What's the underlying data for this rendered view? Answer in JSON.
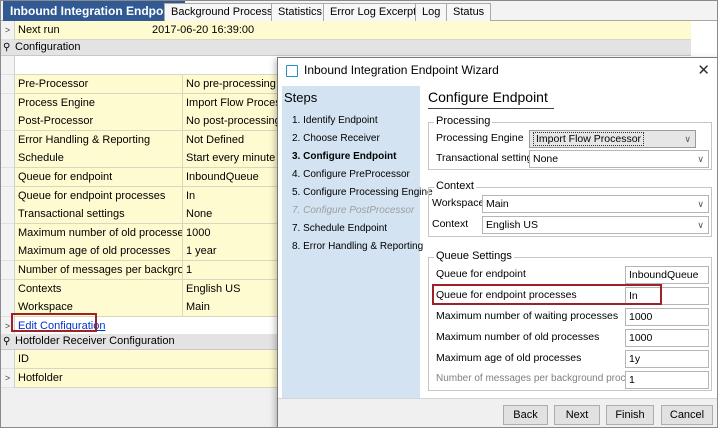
{
  "tabs": [
    {
      "label": "Inbound Integration Endpoint"
    },
    {
      "label": "Background Processes"
    },
    {
      "label": "Statistics"
    },
    {
      "label": "Error Log Excerpts"
    },
    {
      "label": "Log"
    },
    {
      "label": "Status"
    }
  ],
  "next_run": {
    "label": "Next run",
    "value": "2017-06-20 16:39:00"
  },
  "configuration": {
    "section_label": "Configuration",
    "rows": [
      {
        "label": "Pre-Processor",
        "value": "No pre-processing"
      },
      {
        "label": "Process Engine",
        "value": "Import Flow Processor"
      },
      {
        "label": "Post-Processor",
        "value": "No post-processing"
      },
      {
        "label": "Error Handling & Reporting",
        "value": "Not Defined"
      },
      {
        "label": "Schedule",
        "value": "Start every minute"
      },
      {
        "label": "Queue for endpoint",
        "value": "InboundQueue"
      },
      {
        "label": "Queue for endpoint processes",
        "value": "In"
      },
      {
        "label": "Transactional settings",
        "value": "None"
      },
      {
        "label": "Maximum number of old processes",
        "value": "1000"
      },
      {
        "label": "Maximum age of old processes",
        "value": "1 year"
      },
      {
        "label": "Number of messages per background pro",
        "value": "1"
      },
      {
        "label": "Contexts",
        "value": "English US"
      },
      {
        "label": "Workspace",
        "value": "Main"
      }
    ],
    "edit_link": "Edit Configuration"
  },
  "hotfolder_receiver": {
    "section_label": "Hotfolder Receiver Configuration",
    "id_label": "ID"
  },
  "hotfolder": {
    "label": "Hotfolder"
  },
  "dialog": {
    "title": "Inbound Integration Endpoint Wizard",
    "steps_title": "Steps",
    "steps": [
      "1. Identify Endpoint",
      "2. Choose Receiver",
      "3. Configure Endpoint",
      "4. Configure PreProcessor",
      "5. Configure Processing Engine",
      "7. Configure PostProcessor",
      "7. Schedule Endpoint",
      "8. Error Handling & Reporting"
    ],
    "content_title": "Configure Endpoint",
    "processing": {
      "group_label": "Processing",
      "engine_label": "Processing Engine",
      "engine_value": "Import Flow Processor",
      "transactional_label": "Transactional settings",
      "transactional_value": "None"
    },
    "context": {
      "group_label": "Context",
      "workspace_label": "Workspace",
      "workspace_value": "Main",
      "context_label": "Context",
      "context_value": "English US"
    },
    "queue": {
      "group_label": "Queue Settings",
      "endpoint_label": "Queue for endpoint",
      "endpoint_value": "InboundQueue",
      "processes_label": "Queue for endpoint processes",
      "processes_value": "In",
      "waiting_label": "Maximum number of waiting processes",
      "waiting_value": "1000",
      "old_label": "Maximum number of old processes",
      "old_value": "1000",
      "age_label": "Maximum age of old processes",
      "age_value": "1y",
      "messages_label": "Number of messages per background process",
      "messages_value": "1"
    },
    "buttons": {
      "back": "Back",
      "next": "Next",
      "finish": "Finish",
      "cancel": "Cancel"
    }
  },
  "colors": {
    "tab_active": "#315a94",
    "steps_bg": "#d3e3f1",
    "highlight": "#9d2226",
    "row_bg": "#fffbd0"
  }
}
